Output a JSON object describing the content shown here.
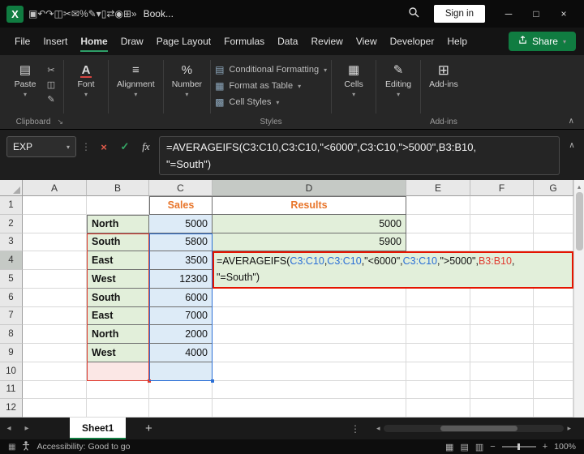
{
  "colors": {
    "accent_green": "#107C41",
    "fill_green": "#E2EFDA",
    "fill_blue": "#DDEBF7",
    "fill_pink": "#FBE7E5",
    "range_blue": "#2A6FD6",
    "range_red": "#E03A2F",
    "header_orange": "#E8762C",
    "annotation_red": "#E51400"
  },
  "icons": {
    "excel_logo": "X",
    "minimize": "─",
    "maximize": "□",
    "close": "×",
    "chevron_down": "▾",
    "chevron_up": "∧",
    "dots_v": "⋮",
    "cancel": "×",
    "enter": "✓",
    "cut": "✂",
    "copy": "◫",
    "format_painter": "✎",
    "font": "A",
    "alignment": "≡",
    "number": "%",
    "cells": "▦",
    "editing": "✎",
    "addins": "⊞",
    "launcher": "↘",
    "nav_left": "◂",
    "nav_right": "▸",
    "add_sheet": "+",
    "vscroll_up": "▴",
    "view_normal": "▦",
    "view_layout": "▤",
    "view_break": "▥",
    "zoom_out": "−",
    "zoom_in": "+",
    "macro": "▦",
    "paste": "▤"
  },
  "title_bar": {
    "workbook_name": "Book...",
    "sign_in": "Sign in",
    "qat": [
      {
        "name": "save-icon",
        "glyph": "▣"
      },
      {
        "name": "undo-icon",
        "glyph": "↶"
      },
      {
        "name": "redo-icon",
        "glyph": "↷"
      },
      {
        "name": "copy-icon",
        "glyph": "◫"
      },
      {
        "name": "cut-icon",
        "glyph": "✂"
      },
      {
        "name": "mail-icon",
        "glyph": "✉"
      },
      {
        "name": "percent-style-icon",
        "glyph": "%"
      },
      {
        "name": "paintbrush-icon",
        "glyph": "✎"
      },
      {
        "name": "chevron-down-icon",
        "glyph": "▾"
      },
      {
        "name": "document-icon",
        "glyph": "▯"
      },
      {
        "name": "swap-arrows-icon",
        "glyph": "⇄"
      },
      {
        "name": "camera-icon",
        "glyph": "◉"
      },
      {
        "name": "table-grid-icon",
        "glyph": "⊞"
      },
      {
        "name": "overflow-icon",
        "glyph": "»"
      }
    ]
  },
  "menu": {
    "tabs": [
      "File",
      "Insert",
      "Home",
      "Draw",
      "Page Layout",
      "Formulas",
      "Data",
      "Review",
      "View",
      "Developer",
      "Help"
    ],
    "active": "Home",
    "share": "Share"
  },
  "ribbon": {
    "paste": "Paste",
    "clipboard_group": "Clipboard",
    "font": "Font",
    "alignment": "Alignment",
    "number": "Number",
    "styles_items": [
      {
        "label": "Conditional Formatting",
        "glyph": "▤"
      },
      {
        "label": "Format as Table",
        "glyph": "▦"
      },
      {
        "label": "Cell Styles",
        "glyph": "▩"
      }
    ],
    "styles_group": "Styles",
    "cells": "Cells",
    "editing": "Editing",
    "addins": "Add-ins",
    "addins_group": "Add-ins"
  },
  "formula_bar": {
    "name_box": "EXP",
    "fx": "fx",
    "line1": "=AVERAGEIFS(C3:C10,C3:C10,\"<6000\",C3:C10,\">5000\",B3:B10,",
    "line2": "\"=South\")"
  },
  "sheet": {
    "columns": [
      "A",
      "B",
      "C",
      "D",
      "E",
      "F",
      "G"
    ],
    "num_rows": 12,
    "active_col": "D",
    "active_row": 4,
    "sales_header": "Sales",
    "results_header": "Results",
    "regions": [
      "North",
      "South",
      "East",
      "West",
      "South",
      "East",
      "North",
      "West"
    ],
    "sales": [
      5000,
      5800,
      3500,
      12300,
      6000,
      7000,
      2000,
      4000
    ],
    "results": [
      5000,
      5900
    ]
  },
  "formula_overlay": {
    "line1": [
      {
        "t": "=AVERAGEIFS(",
        "c": "k"
      },
      {
        "t": "C3:C10",
        "c": "b"
      },
      {
        "t": ",",
        "c": "k"
      },
      {
        "t": "C3:C10",
        "c": "b"
      },
      {
        "t": ",\"<6000\",",
        "c": "k"
      },
      {
        "t": "C3:C10",
        "c": "b"
      },
      {
        "t": ",\">5000\",",
        "c": "k"
      },
      {
        "t": "B3:B10",
        "c": "r"
      },
      {
        "t": ",",
        "c": "k"
      }
    ],
    "line2": [
      {
        "t": "\"=South\")",
        "c": "k"
      }
    ]
  },
  "sheet_tabs": {
    "tab": "Sheet1"
  },
  "status_bar": {
    "accessibility": "Accessibility: Good to go",
    "zoom": "100%"
  }
}
